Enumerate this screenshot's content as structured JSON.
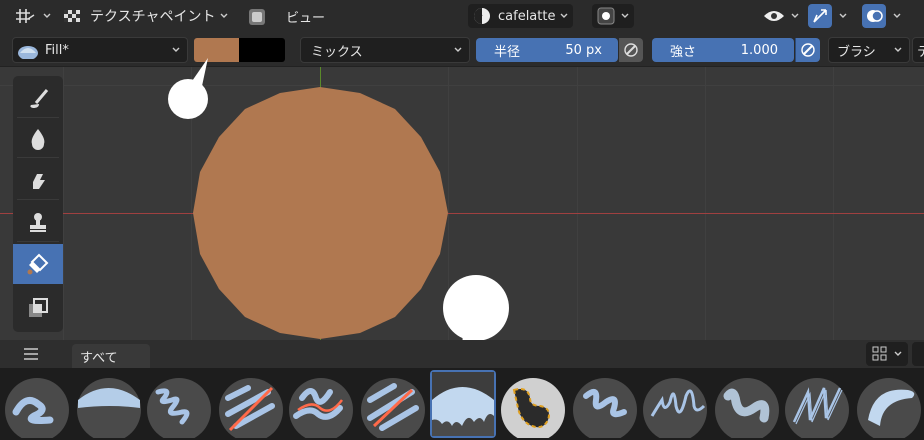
{
  "header": {
    "mode_label": "テクスチャペイント",
    "view_menu": "ビュー",
    "texture_name": "cafelatte"
  },
  "tool_settings": {
    "brush_name": "Fill*",
    "color_primary": "#b07850",
    "color_secondary": "#000000",
    "blend_mode": "ミックス",
    "radius_label": "半径",
    "radius_value": "50 px",
    "strength_label": "強さ",
    "strength_value": "1.000",
    "brush_menu": "ブラシ",
    "overflow_label": "テ"
  },
  "canvas": {
    "fill_color": "#b07850",
    "background": "#393939"
  },
  "asset_shelf": {
    "tab_all": "すべて",
    "thumbnails": [
      "brush-thumb-1",
      "brush-thumb-2",
      "brush-thumb-3",
      "brush-thumb-4",
      "brush-thumb-5",
      "brush-thumb-6",
      "brush-thumb-7-fill-selected",
      "brush-thumb-8",
      "brush-thumb-9",
      "brush-thumb-10",
      "brush-thumb-11",
      "brush-thumb-12",
      "brush-thumb-13"
    ]
  },
  "colors": {
    "accent": "#4772b3",
    "axis_red": "#a04040",
    "axis_green": "#5a8a2a"
  }
}
